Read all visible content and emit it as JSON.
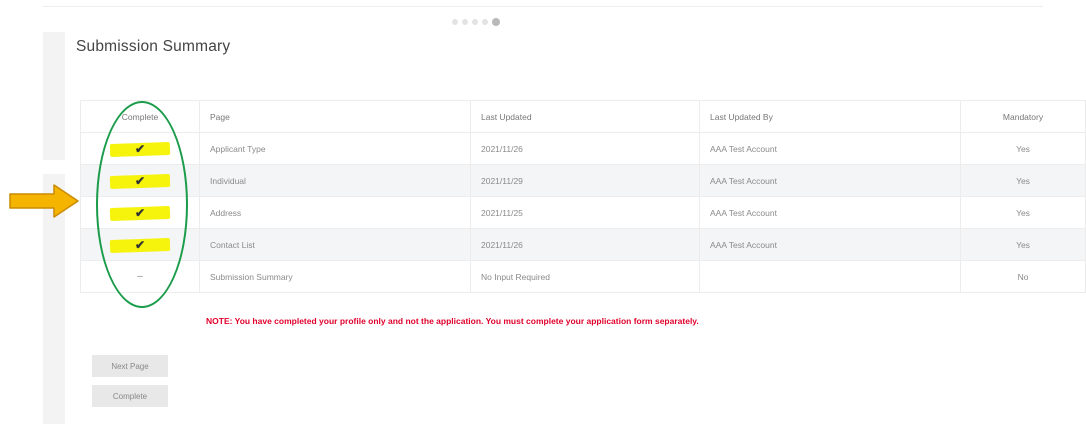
{
  "page": {
    "title": "Submission Summary"
  },
  "stepper": {
    "steps": 5,
    "active_step": 5
  },
  "table": {
    "headers": [
      "Complete",
      "Page",
      "Last Updated",
      "Last Updated By",
      "Mandatory"
    ],
    "rows": [
      {
        "complete": "✔",
        "page": "Applicant Type",
        "updated": "2021/11/26",
        "by": "AAA Test Account",
        "mandatory": "Yes"
      },
      {
        "complete": "✔",
        "page": "Individual",
        "updated": "2021/11/29",
        "by": "AAA Test Account",
        "mandatory": "Yes"
      },
      {
        "complete": "✔",
        "page": "Address",
        "updated": "2021/11/25",
        "by": "AAA Test Account",
        "mandatory": "Yes"
      },
      {
        "complete": "✔",
        "page": "Contact List",
        "updated": "2021/11/26",
        "by": "AAA Test Account",
        "mandatory": "Yes"
      },
      {
        "complete": "–",
        "page": "Submission Summary",
        "updated": "No Input Required",
        "by": "",
        "mandatory": "No"
      }
    ]
  },
  "note": "NOTE: You have completed your profile only and not the application. You must complete your application form separately.",
  "buttons": {
    "next": "Next Page",
    "complete": "Complete"
  },
  "annotations": {
    "highlight_color": "#f5f200",
    "circle_color": "#1a9c4a",
    "arrow_color": "#f5b400"
  }
}
